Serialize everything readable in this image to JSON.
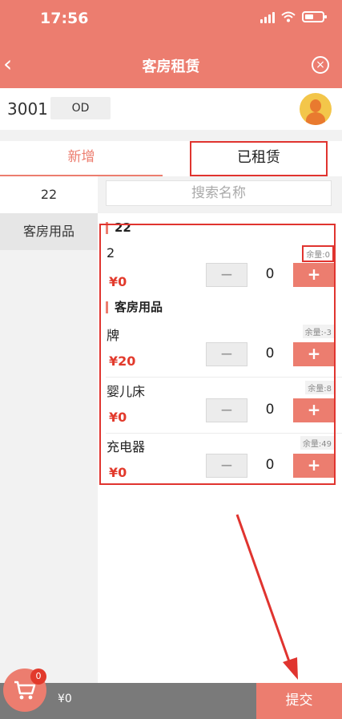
{
  "status_bar": {
    "time": "17:56"
  },
  "header": {
    "title": "客房租赁"
  },
  "room": {
    "number": "3001",
    "status": "OD"
  },
  "tabs": {
    "new_label": "新增",
    "rented_label": "已租赁"
  },
  "categories": [
    {
      "label": "22"
    },
    {
      "label": "客房用品"
    }
  ],
  "search": {
    "placeholder": "搜索名称"
  },
  "groups": [
    {
      "title": "22",
      "items": [
        {
          "name": "2",
          "price": "¥0",
          "stock": "余量:0",
          "qty": "0"
        }
      ]
    },
    {
      "title": "客房用品",
      "items": [
        {
          "name": "牌",
          "price": "¥20",
          "stock": "余量:-3",
          "qty": "0"
        },
        {
          "name": "婴儿床",
          "price": "¥0",
          "stock": "余量:8",
          "qty": "0"
        },
        {
          "name": "充电器",
          "price": "¥0",
          "stock": "余量:49",
          "qty": "0"
        }
      ]
    }
  ],
  "buttons": {
    "minus": "−",
    "plus": "+"
  },
  "footer": {
    "total": "¥0",
    "submit_label": "提交",
    "cart_count": "0"
  },
  "colors": {
    "accent": "#ec7d6f",
    "price": "#e23a2c",
    "annotation": "#e0342f"
  }
}
